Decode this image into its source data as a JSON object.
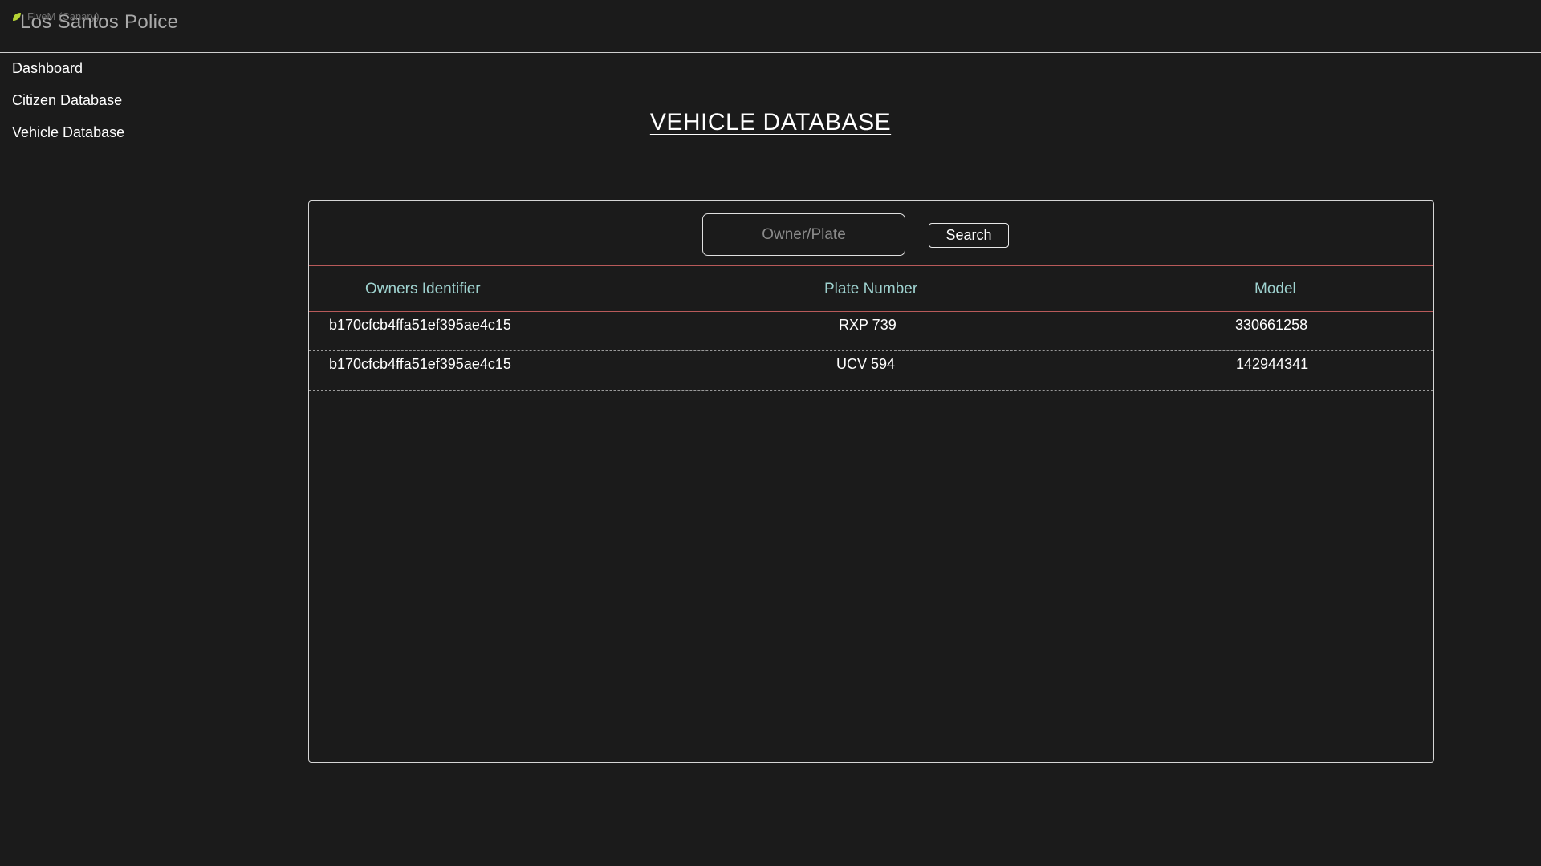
{
  "app": {
    "brand": "Los Santos Police",
    "overlay_label": "FiveM (Canary)"
  },
  "sidebar": {
    "items": [
      {
        "label": "Dashboard"
      },
      {
        "label": "Citizen Database"
      },
      {
        "label": "Vehicle Database"
      }
    ]
  },
  "main": {
    "title": "VEHICLE DATABASE",
    "search": {
      "placeholder": "Owner/Plate",
      "value": "",
      "button_label": "Search"
    },
    "table": {
      "headers": {
        "owner": "Owners Identifier",
        "plate": "Plate Number",
        "model": "Model"
      },
      "rows": [
        {
          "owner": "b170cfcb4ffa51ef395ae4c15",
          "plate": "RXP 739",
          "model": "330661258"
        },
        {
          "owner": "b170cfcb4ffa51ef395ae4c15",
          "plate": "UCV 594",
          "model": "142944341"
        }
      ]
    }
  },
  "colors": {
    "background": "#1b1b1b",
    "header_text": "#9fd3d0",
    "header_border": "#b85a5a",
    "leaf_icon": "#b5d334"
  }
}
